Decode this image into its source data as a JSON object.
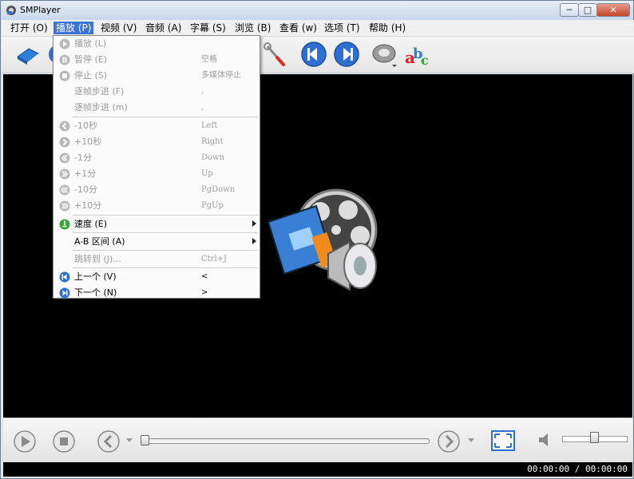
{
  "window": {
    "title": "SMPlayer",
    "controls": {
      "minimize": "─",
      "maximize": "□",
      "close": "✕"
    }
  },
  "menubar": {
    "items": [
      {
        "label": "打开 (O)",
        "active": false
      },
      {
        "label": "播放 (P)",
        "active": true
      },
      {
        "label": "视频 (V)",
        "active": false
      },
      {
        "label": "音频 (A)",
        "active": false
      },
      {
        "label": "字幕 (S)",
        "active": false
      },
      {
        "label": "浏览 (B)",
        "active": false
      },
      {
        "label": "查看 (w)",
        "active": false
      },
      {
        "label": "选项 (T)",
        "active": false
      },
      {
        "label": "帮助 (H)",
        "active": false
      }
    ]
  },
  "toolbar": {
    "icons": [
      "open-file-icon",
      "playlist-icon",
      "preferences-wrench-icon",
      "previous-icon",
      "next-icon",
      "audio-disc-icon",
      "subtitles-abc-icon"
    ]
  },
  "play_menu": {
    "items": [
      {
        "label": "播放 (L)",
        "shortcut": "",
        "icon": "play-icon",
        "enabled": false
      },
      {
        "label": "暂停 (E)",
        "shortcut": "空格",
        "icon": "pause-icon",
        "enabled": false
      },
      {
        "label": "停止 (S)",
        "shortcut": "多媒体停止",
        "icon": "stop-icon",
        "enabled": false
      },
      {
        "label": "逐帧步进 (F)",
        "shortcut": ".",
        "icon": "",
        "enabled": false
      },
      {
        "label": "逐帧步进 (m)",
        "shortcut": ",",
        "icon": "",
        "enabled": false
      },
      {
        "label": "-10秒",
        "shortcut": "Left",
        "icon": "rewind-icon",
        "enabled": false
      },
      {
        "label": "+10秒",
        "shortcut": "Right",
        "icon": "forward-icon",
        "enabled": false
      },
      {
        "label": "-1分",
        "shortcut": "Down",
        "icon": "rewind-icon",
        "enabled": false
      },
      {
        "label": "+1分",
        "shortcut": "Up",
        "icon": "forward-icon",
        "enabled": false
      },
      {
        "label": "-10分",
        "shortcut": "PgDown",
        "icon": "rewind-icon",
        "enabled": false
      },
      {
        "label": "+10分",
        "shortcut": "PgUp",
        "icon": "forward-icon",
        "enabled": false
      },
      {
        "label": "速度 (E)",
        "shortcut": "",
        "icon": "speed-icon",
        "enabled": true,
        "submenu": true
      },
      {
        "label": "A-B 区间 (A)",
        "shortcut": "",
        "icon": "",
        "enabled": true,
        "submenu": true
      },
      {
        "label": "跳转到 (J)...",
        "shortcut": "Ctrl+J",
        "icon": "",
        "enabled": false
      },
      {
        "label": "上一个 (V)",
        "shortcut": "<",
        "icon": "previous-icon",
        "enabled": true
      },
      {
        "label": "下一个 (N)",
        "shortcut": ">",
        "icon": "next-icon",
        "enabled": true
      }
    ]
  },
  "controls": {
    "time": "00:00:00 / 00:00:00",
    "seek_progress": 0.0,
    "volume": 0.5
  },
  "colors": {
    "menu_highlight": "#3b74d8",
    "video_bg": "#000000",
    "icon_blue": "#2e6fd1"
  }
}
